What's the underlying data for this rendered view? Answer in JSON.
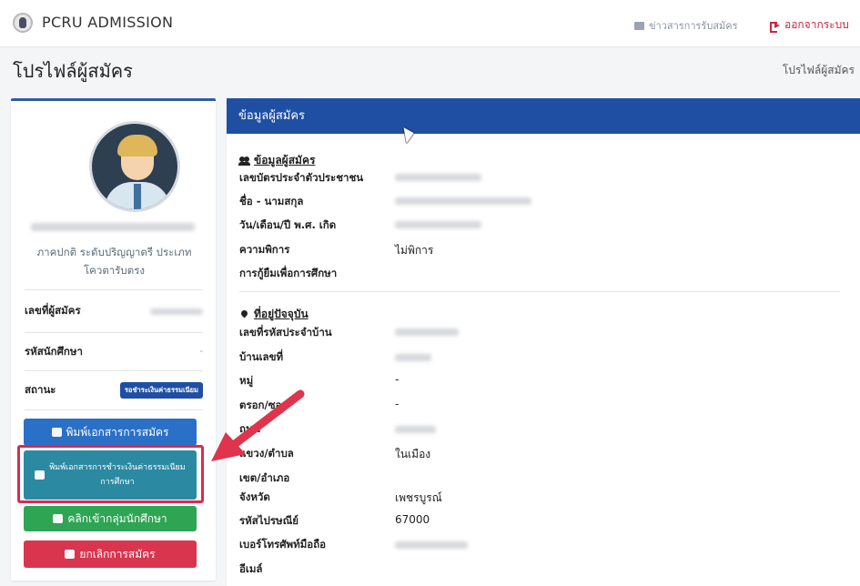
{
  "navbar": {
    "brand": "PCRU ADMISSION",
    "news_label": "ข่าวสารการรับสมัคร",
    "logout_label": "ออกจากระบบ"
  },
  "page": {
    "title": "โปรไฟล์ผู้สมัคร",
    "breadcrumb": "โปรไฟล์ผู้สมัคร"
  },
  "profile": {
    "student_type": "ภาคปกติ ระดับปริญญาตรี ประเภท โควตารับตรง",
    "rows": [
      {
        "label": "เลขที่ผู้สมัคร"
      },
      {
        "label": "รหัสนักศึกษา",
        "value": "-"
      },
      {
        "label": "สถานะ",
        "badge": "รอชำระเงินค่าธรรมเนียม"
      }
    ],
    "buttons": {
      "print_application": "พิมพ์เอกสารการสมัคร",
      "print_fee": "พิมพ์เอกสารการชำระเงินค่าธรรมเนียมการศึกษา",
      "join_group": "คลิกเข้ากลุ่มนักศึกษา",
      "cancel_application": "ยกเลิกการสมัคร"
    }
  },
  "details": {
    "header": "ข้อมูลผู้สมัคร",
    "applicant_section": {
      "title": "ข้อมูลผู้สมัคร",
      "fields": {
        "id_card": "เลขบัตรประจำตัวประชาชน",
        "name": "ชื่อ - นามสกุล",
        "dob": "วัน/เดือน/ปี พ.ศ. เกิด",
        "disability": "ความพิการ",
        "loan": "การกู้ยืมเพื่อการศึกษา"
      },
      "values": {
        "disability": "ไม่พิการ"
      }
    },
    "address_section": {
      "title": "ที่อยู่ปัจจุบัน",
      "fields": {
        "house_code": "เลขที่รหัสประจำบ้าน",
        "house_no": "บ้านเลขที่",
        "moo": "หมู่",
        "soi": "ตรอก/ซอย",
        "road": "ถนน",
        "subdistrict": "แขวง/ตำบล",
        "district": "เขต/อำเภอ",
        "province": "จังหวัด",
        "postcode": "รหัสไปรษณีย์",
        "mobile": "เบอร์โทรศัพท์มือถือ",
        "email": "อีเมล์"
      },
      "values": {
        "moo": "-",
        "soi": "-",
        "subdistrict": "ในเมือง",
        "province": "เพชรบูรณ์",
        "postcode": "67000"
      }
    }
  },
  "colors": {
    "primary": "#1f4fa3",
    "print_button": "#2b70c7",
    "fee_button": "#2b8aa2",
    "group_button": "#2ea553",
    "cancel_button": "#d9354e",
    "highlight": "#d92b4f"
  }
}
